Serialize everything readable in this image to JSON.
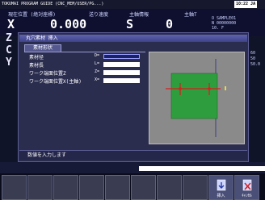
{
  "topbar": {
    "program_path": "TOKUMAI PROGRAM GUIDE (CNC_MEM/USER/PG...)",
    "clock": "10:22 JA"
  },
  "status": {
    "pos_label": "現在位置 (絶対座標)",
    "feed_label": "送り速度",
    "spindle_label": "主軸情報",
    "tool_label": "主軸T",
    "x_axis": "X",
    "x_value": "0.000",
    "s_label": "S",
    "s_value": "0",
    "right_info": [
      "O SAMPLE01",
      "N 00000000"
    ],
    "right_extra": "10.  F"
  },
  "left_axes": [
    "Z",
    "C",
    "Y"
  ],
  "right_col": [
    "60",
    "50",
    "50.0"
  ],
  "dialog": {
    "title": "丸穴素材    挿入",
    "tab_label": "素材形状",
    "fields": [
      {
        "label": "素材径",
        "tag": "D=",
        "value": "100.",
        "selected": true
      },
      {
        "label": "素材長",
        "tag": "L=",
        "value": "",
        "selected": false
      },
      {
        "label": "ワーク端面位置Z",
        "tag": "Z=",
        "value": "",
        "selected": false
      },
      {
        "label": "ワーク端面位置X(主軸)",
        "tag": "X=",
        "value": "",
        "selected": false
      }
    ],
    "message": "数値を入力します"
  },
  "softkeys": [
    {
      "label": "",
      "icon": "blank"
    },
    {
      "label": "",
      "icon": "blank"
    },
    {
      "label": "",
      "icon": "blank"
    },
    {
      "label": "",
      "icon": "blank"
    },
    {
      "label": "",
      "icon": "blank"
    },
    {
      "label": "",
      "icon": "blank"
    },
    {
      "label": "",
      "icon": "blank"
    },
    {
      "label": "",
      "icon": "blank"
    },
    {
      "label": "挿入",
      "icon": "insert-icon"
    },
    {
      "label": "ｷｬﾝｾﾙ",
      "icon": "cancel-icon"
    }
  ],
  "colors": {
    "preview_bg": "#8a8a8a",
    "stock_fill": "#2e9d3e",
    "marker_red": "#d81e1e"
  }
}
